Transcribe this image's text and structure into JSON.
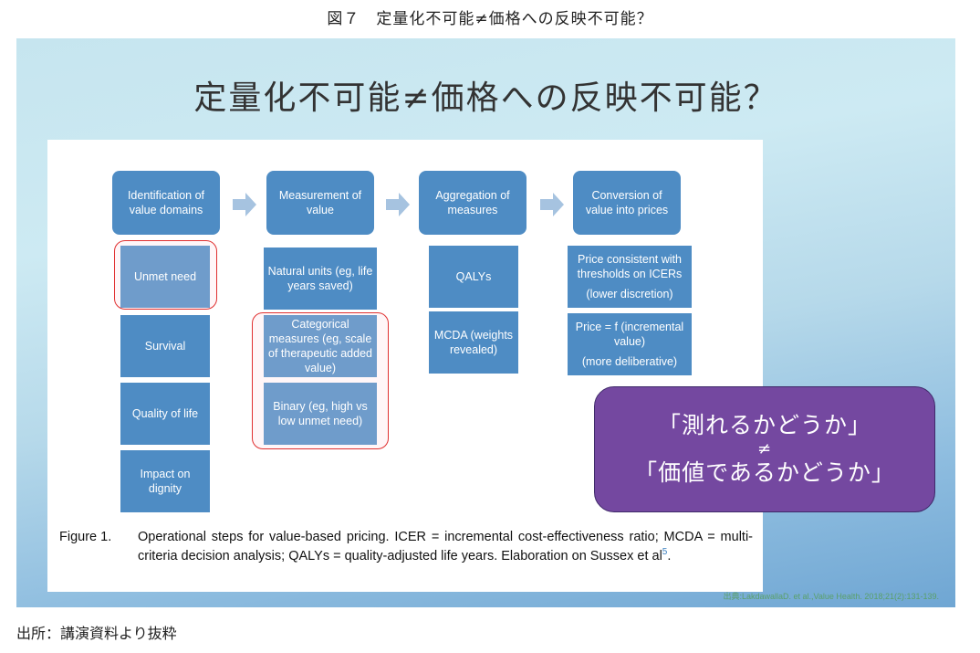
{
  "figure_title": "図７　定量化不可能≠価格への反映不可能？",
  "slide": {
    "title": "定量化不可能≠価格への反映不可能？",
    "columns": [
      {
        "header": "Identification of value domains",
        "items": [
          "Unmet need",
          "Survival",
          "Quality of life",
          "Impact on dignity"
        ]
      },
      {
        "header": "Measurement of value",
        "items": [
          "Natural units (eg, life years saved)",
          "Categorical measures (eg, scale of therapeutic added value)",
          "Binary (eg, high vs low unmet need)"
        ]
      },
      {
        "header": "Aggregation of measures",
        "items": [
          "QALYs",
          "MCDA (weights revealed)"
        ]
      },
      {
        "header": "Conversion of value into prices",
        "items": [
          "Price consistent with thresholds on ICERs",
          "(lower discretion)",
          "Price = f (incremental value)",
          "(more deliberative)"
        ]
      }
    ],
    "caption_label": "Figure 1.",
    "caption_text": "Operational steps for value-based pricing. ICER = incremental cost-effectiveness ratio; MCDA = multi-criteria decision analysis; QALYs = quality-adjusted life years. Elaboration on Sussex et al",
    "caption_ref": "5",
    "caption_end": ".",
    "callout": {
      "line1": "「測れるかどうか」",
      "line2": "≠",
      "line3": "「価値であるかどうか」"
    },
    "source": "出典:LakdawallaD. et al.,Value Health. 2018;21(2):131-139."
  },
  "footer": "出所：講演資料より抜粋",
  "colors": {
    "box_blue": "#4e8cc4",
    "box_light": "#6f9ccb",
    "highlight_ring": "#e03030",
    "callout_purple": "#7448a0"
  }
}
